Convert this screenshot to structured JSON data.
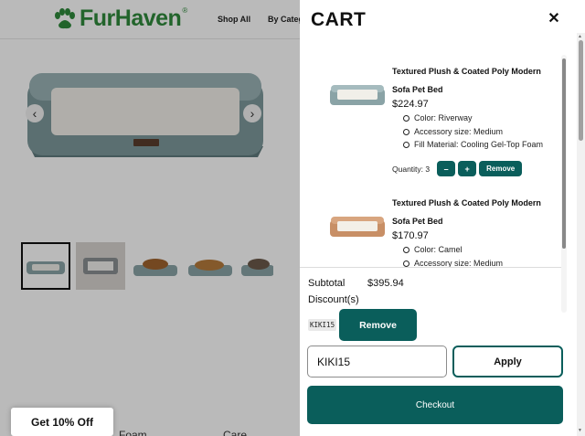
{
  "site": {
    "logo_text": "FurHaven",
    "logo_reg": "®",
    "nav": [
      "Shop All",
      "By Categ"
    ],
    "get_off": "Get 10% Off",
    "bottom_labels": [
      "Foam",
      "Care"
    ],
    "arrows": {
      "prev": "‹",
      "next": "›"
    },
    "brand_color": "#2f8a3c"
  },
  "cart": {
    "title": "CART",
    "close_icon": "✕",
    "items": [
      {
        "name_line1": "Textured Plush & Coated Poly Modern",
        "name_line2": "Sofa Pet Bed",
        "price": "$224.97",
        "attributes": [
          "Color: Riverway",
          "Accessory size: Medium",
          "Fill Material: Cooling Gel-Top Foam"
        ],
        "quantity_label": "Quantity: 3",
        "minus": "–",
        "plus": "+",
        "remove": "Remove",
        "image_color": "riverway"
      },
      {
        "name_line1": "Textured Plush & Coated Poly Modern",
        "name_line2": "Sofa Pet Bed",
        "price": "$170.97",
        "attributes": [
          "Color: Camel",
          "Accessory size: Medium"
        ],
        "image_color": "camel"
      }
    ],
    "subtotal_label": "Subtotal",
    "subtotal_value": "$395.94",
    "discounts_label": "Discount(s)",
    "discount_code": "KIKI15",
    "discount_remove": "Remove",
    "coupon_value": "KIKI15",
    "apply": "Apply",
    "checkout": "Checkout",
    "accent_color": "#0a5e5b"
  }
}
